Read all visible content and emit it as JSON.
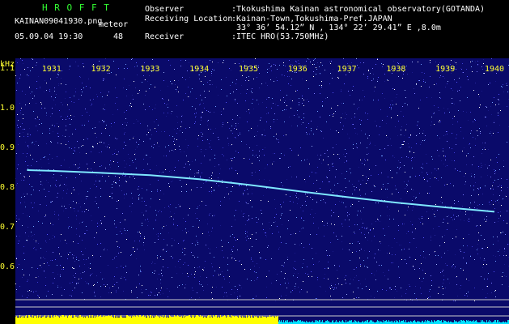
{
  "header": {
    "title": "H R O F F T",
    "filename": "KAINAN09041930.png",
    "meteor_label": "meteor",
    "datetime": "05.09.04 19:30",
    "meteor_count": "48",
    "observer_key": "Observer",
    "observer_value": ":Tkokushima Kainan astronomical observatory(GOTANDA)",
    "location_key": "Receiving Location",
    "location_value": ":Kainan-Town,Tokushima-Pref.JAPAN",
    "coords_value": "33° 36’ 54.12” N , 134° 22’ 29.41” E ,8.0m",
    "receiver_key": "Receiver",
    "receiver_value": ":ITEC HRO(53.750MHz)"
  },
  "colors": {
    "background": "#000000",
    "spectrogram_bg": "#0a0a6a",
    "trace": "#7fe8ff",
    "axis_text": "#ffff33",
    "title_text": "#33ff33",
    "meter_yellow": "#ffff00",
    "meter_cyan": "#00e0ff"
  },
  "chart_data": {
    "type": "line",
    "title": "",
    "xlabel": "",
    "ylabel": "kHz",
    "x_ticks": [
      "1931",
      "1932",
      "1933",
      "1934",
      "1935",
      "1936",
      "1937",
      "1938",
      "1939",
      "1940"
    ],
    "y_ticks": [
      "1.1",
      "1.0",
      "0.9",
      "0.8",
      "0.7",
      "0.6"
    ],
    "ylim": [
      0.6,
      1.15
    ],
    "series": [
      {
        "x": [
          "1930.5",
          "1931",
          "1932",
          "1933",
          "1934",
          "1935",
          "1936",
          "1937",
          "1938",
          "1939",
          "1940"
        ],
        "y": [
          0.845,
          0.843,
          0.838,
          0.832,
          0.822,
          0.808,
          0.792,
          0.777,
          0.763,
          0.751,
          0.74
        ]
      }
    ]
  }
}
